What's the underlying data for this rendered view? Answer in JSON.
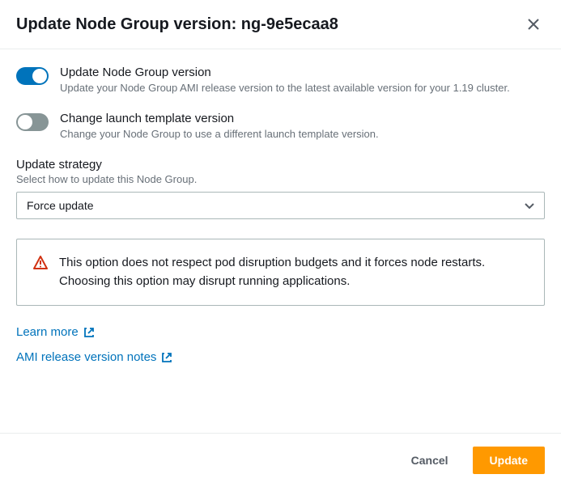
{
  "header": {
    "title": "Update Node Group version: ng-9e5ecaa8"
  },
  "toggles": {
    "update_version": {
      "title": "Update Node Group version",
      "desc": "Update your Node Group AMI release version to the latest available version for your 1.19 cluster.",
      "state": "on"
    },
    "change_template": {
      "title": "Change launch template version",
      "desc": "Change your Node Group to use a different launch template version.",
      "state": "off"
    }
  },
  "strategy": {
    "label": "Update strategy",
    "desc": "Select how to update this Node Group.",
    "selected": "Force update"
  },
  "alert": {
    "text": "This option does not respect pod disruption budgets and it forces node restarts. Choosing this option may disrupt running applications."
  },
  "links": {
    "learn_more": "Learn more",
    "release_notes": "AMI release version notes"
  },
  "footer": {
    "cancel": "Cancel",
    "update": "Update"
  },
  "colors": {
    "accent": "#0073bb",
    "primary_button": "#ff9900",
    "warning": "#d13212"
  }
}
